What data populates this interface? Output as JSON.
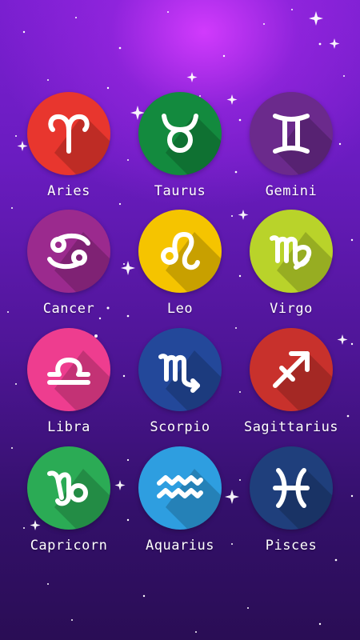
{
  "signs": [
    {
      "label": "Aries",
      "icon": "aries-icon",
      "color": "#e8362e"
    },
    {
      "label": "Taurus",
      "icon": "taurus-icon",
      "color": "#138a3e"
    },
    {
      "label": "Gemini",
      "icon": "gemini-icon",
      "color": "#6b2a8c"
    },
    {
      "label": "Cancer",
      "icon": "cancer-icon",
      "color": "#9b2a8e"
    },
    {
      "label": "Leo",
      "icon": "leo-icon",
      "color": "#f5c400"
    },
    {
      "label": "Virgo",
      "icon": "virgo-icon",
      "color": "#b9d32a"
    },
    {
      "label": "Libra",
      "icon": "libra-icon",
      "color": "#ee3d8f"
    },
    {
      "label": "Scorpio",
      "icon": "scorpio-icon",
      "color": "#23489a"
    },
    {
      "label": "Sagittarius",
      "icon": "sagittarius-icon",
      "color": "#c8312c"
    },
    {
      "label": "Capricorn",
      "icon": "capricorn-icon",
      "color": "#2bab55"
    },
    {
      "label": "Aquarius",
      "icon": "aquarius-icon",
      "color": "#2e9ee0"
    },
    {
      "label": "Pisces",
      "icon": "pisces-icon",
      "color": "#1f3f7c"
    }
  ]
}
